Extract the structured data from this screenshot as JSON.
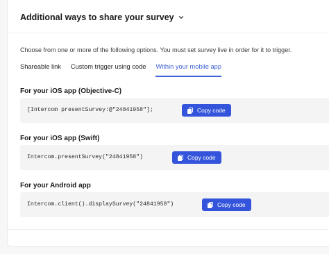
{
  "header": {
    "title": "Additional ways to share your survey"
  },
  "description": "Choose from one or more of the following options. You must set survey live in order for it to trigger.",
  "tabs": [
    {
      "label": "Shareable link",
      "active": false
    },
    {
      "label": "Custom trigger using code",
      "active": false
    },
    {
      "label": "Within your mobile app",
      "active": true
    }
  ],
  "sections": [
    {
      "title": "For your iOS app (Objective-C)",
      "code": "[Intercom presentSurvey:@\"24841958\"];",
      "button": "Copy code"
    },
    {
      "title": "For your iOS app (Swift)",
      "code": "Intercom.presentSurvey(\"24841958\")",
      "button": "Copy code"
    },
    {
      "title": "For your Android app",
      "code": "Intercom.client().displaySurvey(\"24841958\")",
      "button": "Copy code"
    }
  ],
  "colors": {
    "accent": "#3455db",
    "active_tab": "#3d5fd6"
  },
  "icons": {
    "header_toggle": "chevron-down-icon",
    "copy": "copy-icon"
  }
}
